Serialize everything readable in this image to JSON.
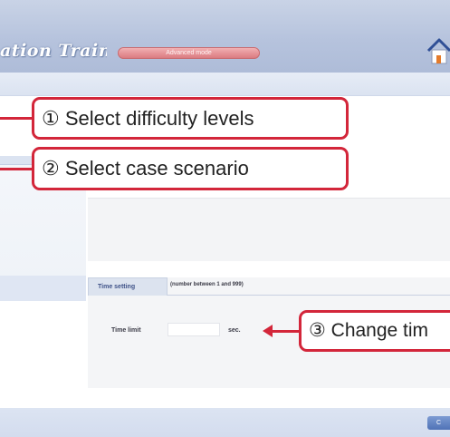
{
  "header": {
    "app_title": "ation Trainer",
    "mode_label": "Advanced mode",
    "home_icon": "home-icon"
  },
  "callouts": {
    "select_difficulty": "① Select difficulty levels",
    "select_scenario": "② Select case scenario",
    "change_time": "③ Change tim"
  },
  "time_setting": {
    "tab_label": "Time setting",
    "hint": "(number between 1 and 999)",
    "time_limit_label": "Time limit",
    "time_limit_value": "",
    "unit": "sec."
  },
  "footer": {
    "button_label": "C"
  },
  "colors": {
    "callout_red": "#d3263a",
    "header_blue": "#b6c3dd",
    "mode_pill_pink": "#e48f93"
  }
}
